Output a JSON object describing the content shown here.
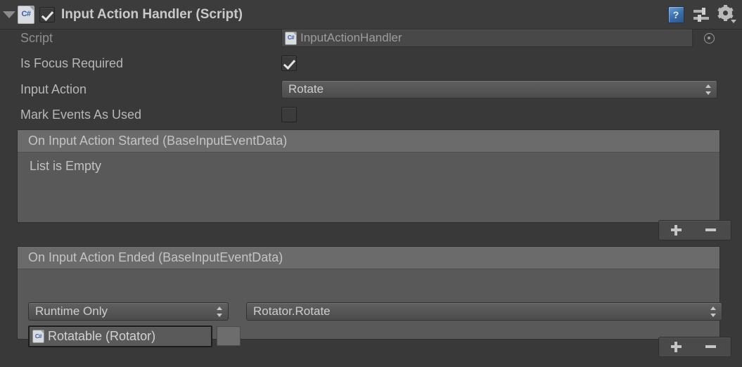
{
  "component": {
    "title": "Input Action Handler (Script)",
    "enabled": true,
    "foldout_expanded": true,
    "icons": {
      "script": "csharp-script-icon",
      "help": "help-book-icon",
      "preset": "preset-slider-icon",
      "settings": "gear-icon"
    }
  },
  "properties": {
    "script": {
      "label": "Script",
      "value": "InputActionHandler",
      "readonly": true
    },
    "is_focus_required": {
      "label": "Is Focus Required",
      "checked": true
    },
    "input_action": {
      "label": "Input Action",
      "value": "Rotate"
    },
    "mark_events_as_used": {
      "label": "Mark Events As Used",
      "checked": false
    }
  },
  "events": [
    {
      "header": "On Input Action Started (BaseInputEventData)",
      "empty_text": "List is Empty",
      "entries": [],
      "add_label": "+",
      "remove_label": "–"
    },
    {
      "header": "On Input Action Ended (BaseInputEventData)",
      "empty_text": "",
      "entries": [
        {
          "call_state": "Runtime Only",
          "method": "Rotator.Rotate",
          "target_object": "Rotatable (Rotator)"
        }
      ],
      "add_label": "+",
      "remove_label": "–"
    }
  ],
  "colors": {
    "background": "#393939",
    "header_bg": "#3c3c3c",
    "event_box_bg": "#595959",
    "event_header_bg": "#6b6b6b",
    "text": "#b7b7b7",
    "accent_blue": "#3a6ca8"
  }
}
